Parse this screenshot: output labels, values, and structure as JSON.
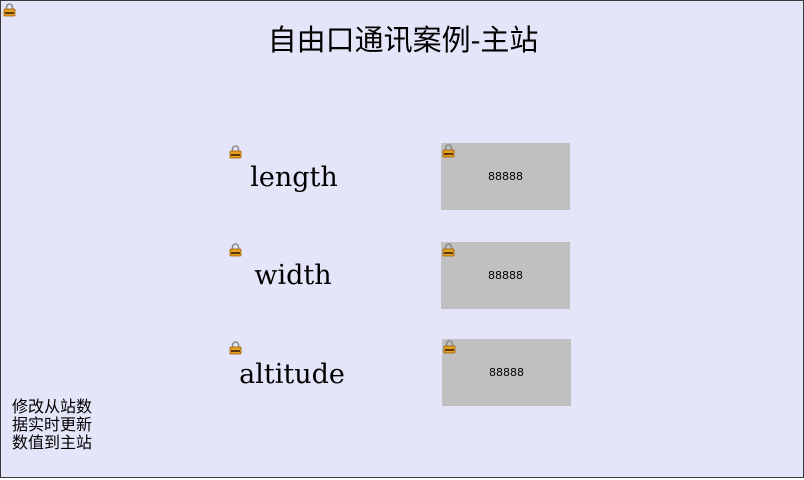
{
  "title": "自由口通讯案例-主站",
  "fields": [
    {
      "label": "length",
      "value": "88888"
    },
    {
      "label": "width",
      "value": "88888"
    },
    {
      "label": "altitude",
      "value": "88888"
    }
  ],
  "note_lines": [
    "修改从站数",
    "据实时更新",
    "数值到主站"
  ],
  "icons": {
    "lock": "padlock-icon"
  },
  "colors": {
    "background": "#e5e5fa",
    "value_box": "#c0c0c0",
    "lock_body": "#e8a020"
  }
}
